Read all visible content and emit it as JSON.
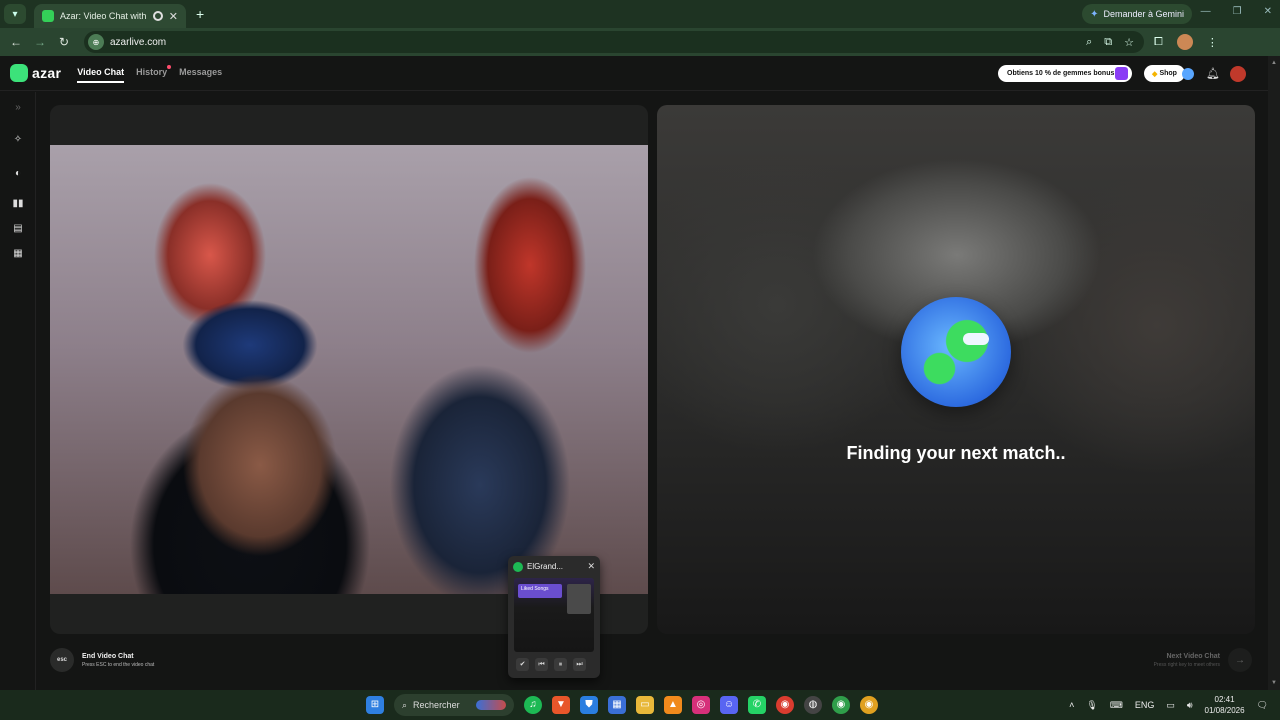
{
  "browser": {
    "tab_title": "Azar: Video Chat with New",
    "new_tab": "+",
    "gemini_label": "Demander à Gemini",
    "url": "azarlive.com"
  },
  "app": {
    "logo_text": "azar",
    "nav": [
      {
        "label": "Video Chat",
        "active": true
      },
      {
        "label": "History",
        "has_dot": true
      },
      {
        "label": "Messages"
      }
    ],
    "promo_label": "Obtiens 10 % de gemmes bonus !",
    "shop_label": "Shop",
    "finding_text": "Finding your next match..",
    "end_chat": {
      "key": "esc",
      "title": "End Video Chat",
      "subtitle": "Press ESC to end the video chat"
    },
    "next_chat": {
      "title": "Next Video Chat",
      "subtitle": "Press right key to meet others"
    }
  },
  "mini_player": {
    "title": "ElGrand...",
    "banner": "Liked Songs"
  },
  "taskbar": {
    "search_placeholder": "Rechercher",
    "language": "ENG",
    "time": "02:41",
    "date": "01/08/2026"
  },
  "colors": {
    "brand": "#3ce27a",
    "browser_frame": "#1e3322",
    "spotify": "#1db954"
  }
}
